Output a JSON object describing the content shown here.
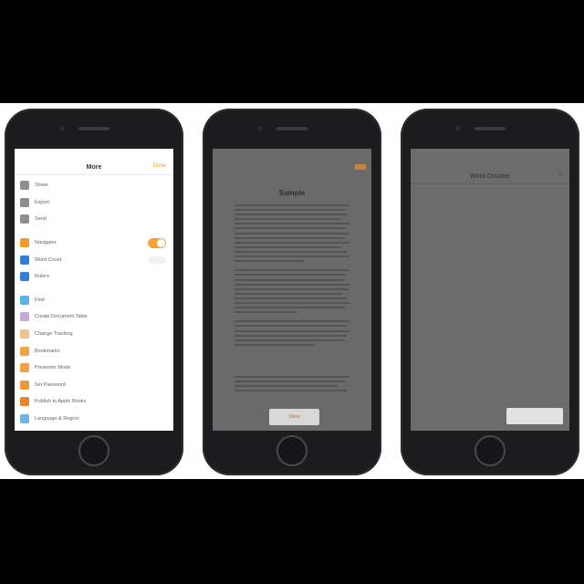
{
  "phone1": {
    "status": {
      "carrier": "",
      "time": "",
      "battery": ""
    },
    "nav": {
      "title": "More",
      "done_label": "Done"
    },
    "menu_group1": [
      {
        "label": "Share",
        "icon": "share-icon",
        "color": "#8e8e93"
      },
      {
        "label": "Export",
        "icon": "export-icon",
        "color": "#8e8e93"
      },
      {
        "label": "Send",
        "icon": "send-icon",
        "color": "#8e8e93"
      }
    ],
    "menu_group2": [
      {
        "label": "Navigator",
        "icon": "navigator-icon",
        "color": "#f39c2e",
        "toggle": "on"
      },
      {
        "label": "Word Count",
        "icon": "word-count-icon",
        "color": "#2f7fd8",
        "toggle": "off"
      },
      {
        "label": "Rulers",
        "icon": "rulers-icon",
        "color": "#2f7fd8"
      }
    ],
    "menu_group3": [
      {
        "label": "Find",
        "icon": "find-icon",
        "color": "#59b2e8"
      },
      {
        "label": "Create Document Table",
        "icon": "table-icon",
        "color": "#c4a9d6"
      },
      {
        "label": "Change Tracking",
        "icon": "tracking-icon",
        "color": "#f0c090"
      },
      {
        "label": "Bookmarks",
        "icon": "bookmarks-icon",
        "color": "#f1a246"
      },
      {
        "label": "Presenter Mode",
        "icon": "presenter-icon",
        "color": "#f1a246"
      },
      {
        "label": "Set Password",
        "icon": "password-icon",
        "color": "#e89a3c"
      },
      {
        "label": "Publish to Apple Books",
        "icon": "books-icon",
        "color": "#e8872c"
      },
      {
        "label": "Language & Region",
        "icon": "language-icon",
        "color": "#6fb3e6"
      }
    ]
  },
  "phone2": {
    "toolbar": {
      "back_label": "",
      "title": ""
    },
    "doc_title": "Sample",
    "doc_subtitle": "",
    "line_widths": [
      100,
      96,
      98,
      92,
      100,
      97,
      99,
      95,
      100,
      93,
      98,
      100,
      60,
      0,
      100,
      97,
      95,
      100,
      99,
      94,
      98,
      100,
      96,
      55,
      0,
      100,
      97,
      100,
      98,
      95,
      70
    ],
    "footer_line_widths": [
      100,
      96,
      90,
      98
    ],
    "toast_label": "Show"
  },
  "phone3": {
    "header_title": "Word Counter",
    "close_label": "×",
    "rows": [
      "",
      "",
      ""
    ],
    "button_label": ""
  }
}
